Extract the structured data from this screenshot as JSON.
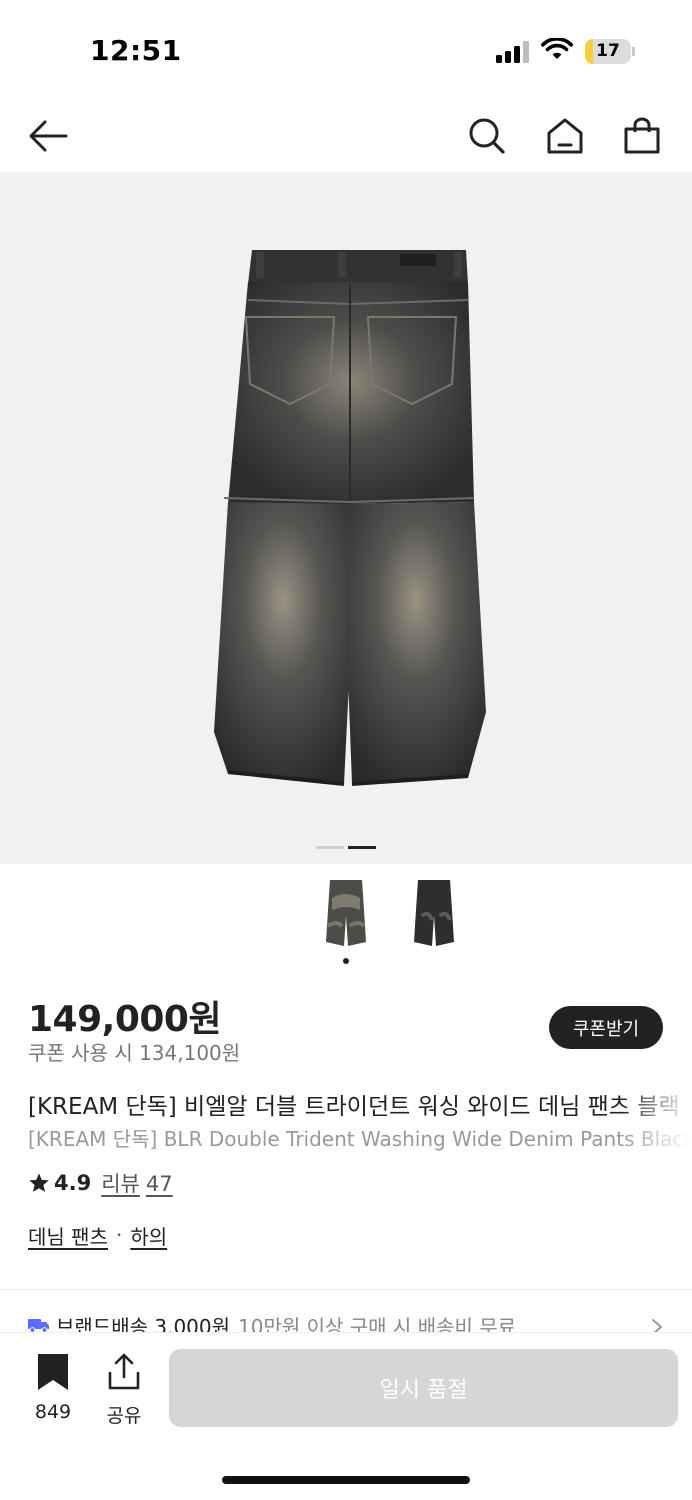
{
  "status_bar": {
    "time": "12:51",
    "battery_level": "17",
    "battery_fraction": 0.17,
    "icons": [
      "cellular-signal-icon",
      "wifi-icon",
      "battery-icon"
    ]
  },
  "nav": {
    "icons": [
      "back-arrow-icon",
      "search-icon",
      "home-icon",
      "shopping-bag-icon"
    ]
  },
  "gallery": {
    "total_images": 2,
    "current_index": 2,
    "thumbnail_count": 2,
    "selected_thumbnail": 1
  },
  "product": {
    "price": "149,000원",
    "coupon_price": "쿠폰 사용 시 134,100원",
    "coupon_button": "쿠폰받기",
    "title_ko": "[KREAM 단독] 비엘알 더블 트라이던트 워싱 와이드 데님 팬츠 블랙",
    "title_en": "[KREAM 단독] BLR Double Trident Washing Wide Denim Pants Black",
    "rating": "4.9",
    "review_label": "리뷰",
    "review_count": "47",
    "categories": [
      "데님 팬츠",
      "하의"
    ],
    "category_separator": "·"
  },
  "shipping": {
    "main": "브랜드배송 3,000원",
    "sub": "10만원 이상 구매 시 배송비 무료",
    "icon": "delivery-truck-icon",
    "accent": "#5b6cff"
  },
  "bottom_bar": {
    "save_count": "849",
    "share_label": "공유",
    "soldout_label": "일시 품절"
  },
  "colors": {
    "text": "#222222",
    "muted": "#777777",
    "hero_background": "#f1f1f1",
    "soldout_button": "#d6d6d6"
  }
}
